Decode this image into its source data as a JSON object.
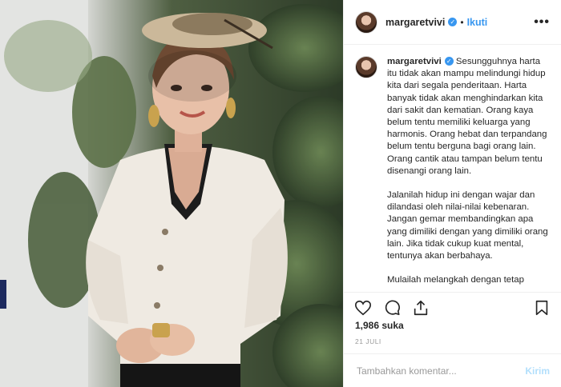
{
  "header": {
    "username": "margaretvivi",
    "dot": "•",
    "follow_label": "Ikuti",
    "more_label": "•••"
  },
  "caption": {
    "username": "margaretvivi",
    "paragraphs": [
      "Sesungguhnya harta itu tidak akan mampu melindungi hidup kita dari segala penderitaan. Harta banyak tidak akan menghindarkan kita dari sakit dan kematian. Orang kaya belum tentu memiliki keluarga yang harmonis. Orang hebat dan terpandang belum tentu berguna bagi orang lain. Orang cantik atau tampan belum tentu disenangi orang lain.",
      "Jalanilah hidup ini dengan wajar dan dilandasi oleh nilai-nilai kebenaran. Jangan gemar membandingkan apa yang dimiliki dengan yang dimiliki orang lain. Jika tidak cukup kuat mental, tentunya akan berbahaya.",
      "Mulailah melangkah dengan tetap"
    ]
  },
  "stats": {
    "likes": "1,986 suka",
    "date": "21 JULI"
  },
  "comment_box": {
    "placeholder": "Tambahkan komentar...",
    "post_label": "Kirim"
  },
  "colors": {
    "link_blue": "#3897f0",
    "post_disabled": "#b2dffc",
    "text": "#262626",
    "muted": "#999999"
  },
  "icons": [
    "heart-icon",
    "comment-icon",
    "share-icon",
    "bookmark-icon",
    "verified-badge-icon"
  ]
}
